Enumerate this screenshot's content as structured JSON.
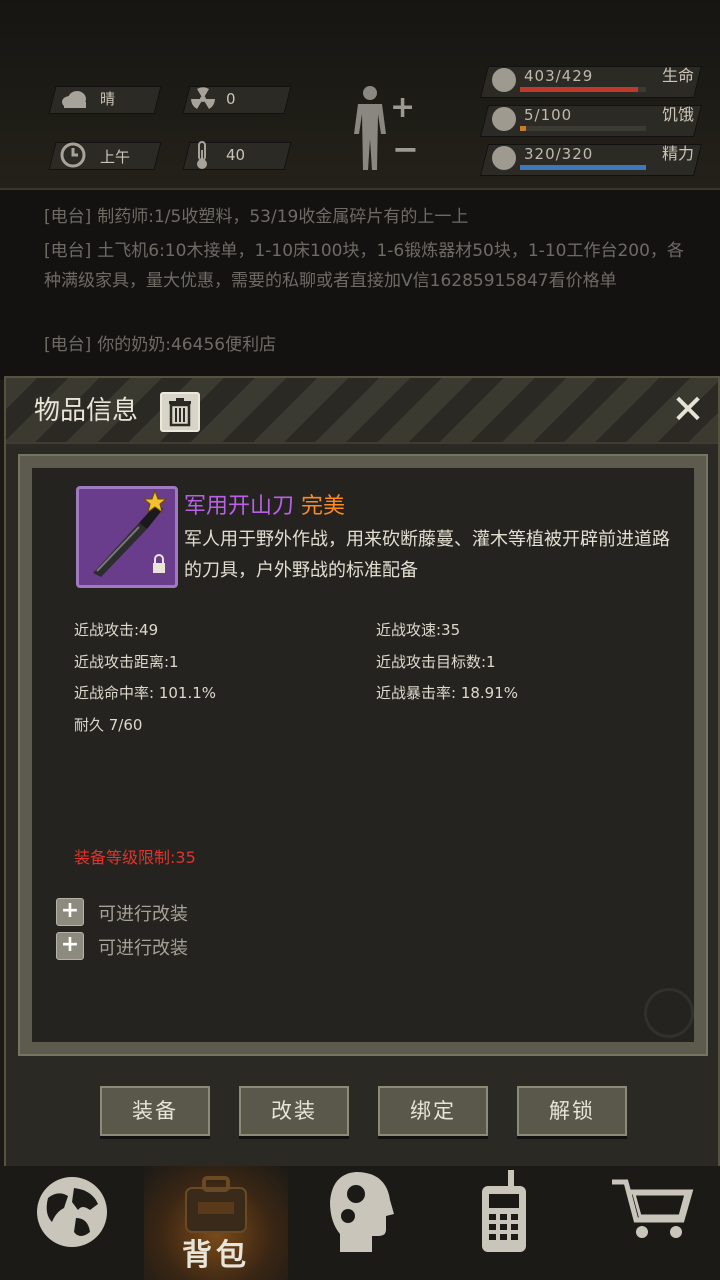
{
  "status": {
    "weather": {
      "icon": "cloud-icon",
      "label": "晴"
    },
    "radiation": {
      "icon": "radiation-icon",
      "value": "0"
    },
    "time": {
      "icon": "clock-icon",
      "label": "上午"
    },
    "temperature": {
      "icon": "thermometer-icon",
      "value": "40"
    },
    "bars": [
      {
        "name": "生命",
        "value": "403/429",
        "fraction": 0.939,
        "color": "#c0392b",
        "icon": "heart-icon"
      },
      {
        "name": "饥饿",
        "value": "5/100",
        "fraction": 0.05,
        "color": "#c87b2a",
        "icon": "stomach-icon"
      },
      {
        "name": "精力",
        "value": "320/320",
        "fraction": 1.0,
        "color": "#3e78b8",
        "icon": "brain-icon"
      }
    ]
  },
  "chat": [
    {
      "tag": "[电台]",
      "text": "制药师:1/5收塑料，53/19收金属碎片有的上一上"
    },
    {
      "tag": "[电台]",
      "text": "土飞机6:10木接单，1-10床100块，1-6锻炼器材50块，1-10工作台200，各种满级家具，量大优惠，需要的私聊或者直接加V信16285915847看价格单"
    },
    {
      "tag": "[电台]",
      "text": "你的奶奶:46456便利店"
    }
  ],
  "dialog": {
    "title": "物品信息",
    "item": {
      "name": "军用开山刀",
      "quality": "完美",
      "name_color": "#b860e6",
      "quality_color": "#ff8a1f",
      "description": "军人用于野外作战，用来砍断藤蔓、灌木等植被开辟前进道路的刀具，户外野战的标准配备",
      "stats": [
        "近战攻击:49",
        "近战攻速:35",
        "近战攻击距离:1",
        "近战攻击目标数:1",
        "近战命中率: 101.1%",
        "近战暴击率: 18.91%",
        "耐久 7/60"
      ],
      "requirement": "装备等级限制:35",
      "mods": [
        "可进行改装",
        "可进行改装"
      ]
    },
    "buttons": [
      "装备",
      "改装",
      "绑定",
      "解锁"
    ]
  },
  "nav": [
    {
      "name": "map",
      "icon": "globe-icon",
      "label": ""
    },
    {
      "name": "backpack",
      "icon": "backpack-icon",
      "label": "背包",
      "active": true
    },
    {
      "name": "skills",
      "icon": "head-gears-icon",
      "label": ""
    },
    {
      "name": "radio",
      "icon": "walkie-talkie-icon",
      "label": ""
    },
    {
      "name": "shop",
      "icon": "cart-icon",
      "label": ""
    }
  ]
}
